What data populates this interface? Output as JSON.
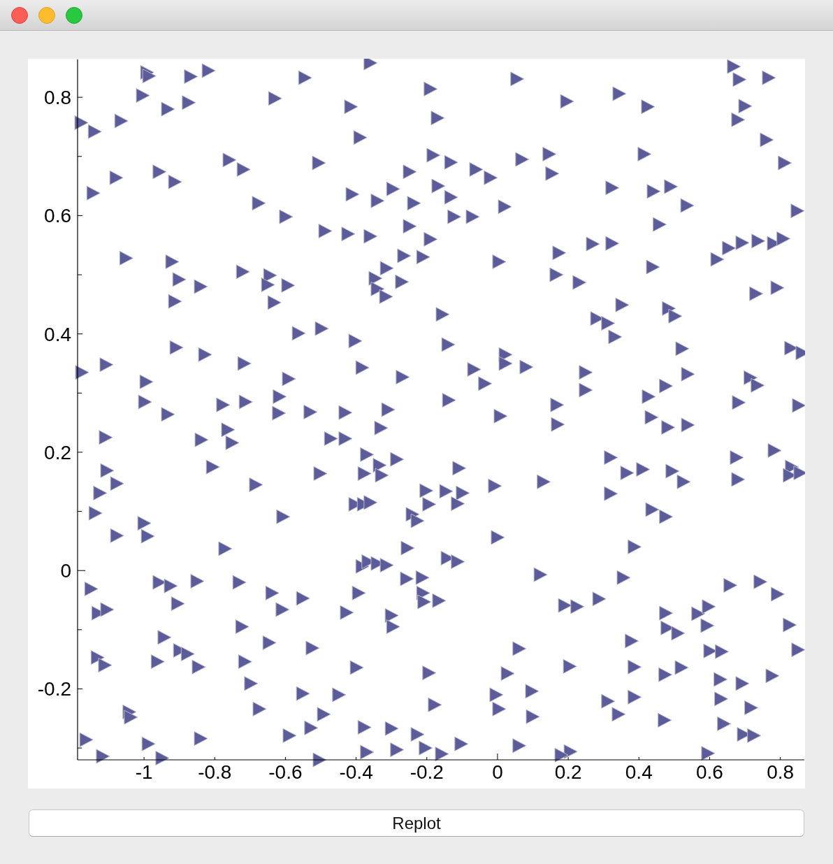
{
  "chart": {
    "chart_data": {
      "type": "scatter",
      "xlim": [
        -1.188,
        0.868
      ],
      "ylim": [
        -0.32,
        0.864
      ],
      "xticks": [
        -1,
        -0.8,
        -0.6,
        -0.4,
        -0.2,
        0,
        0.2,
        0.4,
        0.6,
        0.8
      ],
      "yticks": [
        -0.2,
        0,
        0.2,
        0.4,
        0.6,
        0.8
      ],
      "x": [
        -0.36,
        -0.992,
        -0.986,
        -0.868,
        -0.818,
        -0.545,
        0.055,
        0.668,
        0.684,
        0.767,
        -1.004,
        -0.933,
        -0.874,
        -0.63,
        -0.415,
        -0.19,
        0.196,
        0.344,
        0.425,
        0.7,
        0.68,
        -0.17,
        -1.178,
        -1.14,
        -1.065,
        -0.389,
        0.761,
        0.415,
        -0.759,
        -0.719,
        -0.506,
        -0.182,
        -0.132,
        -0.061,
        -0.02,
        -0.249,
        0.146,
        0.154,
        0.069,
        0.812,
        -0.957,
        -0.913,
        -1.079,
        -1.144,
        -0.411,
        -0.34,
        -0.296,
        -0.168,
        -0.132,
        -0.237,
        0.02,
        0.324,
        0.441,
        0.49,
        0.536,
        -0.676,
        -0.599,
        0.848,
        -0.488,
        -0.423,
        -0.36,
        -0.249,
        -0.19,
        -0.123,
        -0.071,
        0.458,
        -1.051,
        -0.921,
        0.174,
        0.269,
        0.324,
        -0.265,
        -0.211,
        0.004,
        0.621,
        0.654,
        0.692,
        0.737,
        0.781,
        0.808,
        -0.721,
        -0.644,
        -0.314,
        -0.346,
        -0.271,
        0.439,
        0.166,
        0.231,
        -0.901,
        -0.84,
        -0.65,
        -0.593,
        -0.913,
        -0.632,
        -0.34,
        -0.316,
        0.731,
        0.791,
        -0.156,
        0.352,
        0.484,
        0.502,
        0.281,
        0.312,
        0.332,
        -0.563,
        -0.498,
        -0.403,
        -0.14,
        0.022,
        0.522,
        0.83,
        0.862,
        -0.909,
        -0.828,
        -1.176,
        -1.107,
        -0.717,
        -0.383,
        -0.269,
        -0.591,
        -0.067,
        -0.036,
        0.022,
        0.081,
        0.249,
        0.249,
        0.538,
        0.476,
        0.715,
        0.735,
        -0.994,
        -0.998,
        -0.777,
        -0.713,
        -0.617,
        -0.619,
        -0.53,
        -0.431,
        -0.31,
        -0.138,
        0.168,
        0.427,
        0.682,
        0.852,
        -0.933,
        0.008,
        0.435,
        0.482,
        0.538,
        0.17,
        -0.763,
        -0.751,
        -0.33,
        -1.109,
        -0.838,
        -0.472,
        -0.431,
        -0.37,
        -0.285,
        0.783,
        0.32,
        0.676,
        -0.806,
        -1.105,
        -1.077,
        -1.125,
        -1.138,
        -0.502,
        -0.334,
        -0.377,
        -0.328,
        -0.109,
        0.366,
        0.411,
        0.494,
        0.526,
        0.832,
        0.826,
        0.856,
        -0.684,
        -0.202,
        -0.146,
        -0.099,
        -0.008,
        0.13,
        0.32,
        0.68,
        -0.403,
        -0.379,
        -0.36,
        -0.194,
        -0.113,
        -0.241,
        -0.227,
        0.437,
        0.476,
        -0.607,
        -1,
        -0.99,
        -1.077,
        0,
        -0.771,
        -0.255,
        0.387,
        -0.142,
        -0.113,
        -0.383,
        -0.366,
        -0.34,
        -0.314,
        -0.731,
        -0.957,
        -0.925,
        -0.85,
        -1.15,
        -0.905,
        -0.638,
        -0.551,
        -0.393,
        -0.257,
        -0.213,
        -0.211,
        -0.208,
        -0.166,
        0.121,
        0.356,
        0.658,
        0.743,
        0.792,
        -0.609,
        0.19,
        0.225,
        0.287,
        -0.427,
        -0.3,
        -0.296,
        -1.13,
        -1.105,
        0.476,
        0.48,
        0.51,
        0.567,
        0.597,
        0.593,
        0.826,
        -0.723,
        -0.943,
        -0.899,
        -0.877,
        -0.646,
        -0.524,
        0.061,
        0.379,
        0.85,
        -1.132,
        -1.111,
        -0.962,
        -0.846,
        -0.715,
        -0.399,
        -0.194,
        0.028,
        0.204,
        0.387,
        0.474,
        0.52,
        0.601,
        0.634,
        0.63,
        0.692,
        0.777,
        -0.698,
        -0.551,
        -0.449,
        -0.004,
        0.097,
        0.312,
        0.387,
        0.632,
        0.717,
        -0.178,
        0.004,
        -1.042,
        -1.038,
        -0.492,
        -0.674,
        0.342,
        0.099,
        0.472,
        0.64,
        0.696,
        0.725,
        -0.377,
        -0.3,
        -0.528,
        -0.589,
        -0.84,
        -0.227,
        -1.164,
        -0.988,
        -0.103,
        0.061,
        -0.204,
        -0.285,
        -0.37,
        0.206,
        0.18,
        0.595,
        -0.158,
        -1.117,
        -0.949,
        -0.504
      ],
      "series": [
        {
          "color": "#5b5c99",
          "values": [
            0.858,
            0.842,
            0.836,
            0.835,
            0.845,
            0.833,
            0.831,
            0.852,
            0.83,
            0.833,
            0.803,
            0.78,
            0.791,
            0.798,
            0.784,
            0.814,
            0.793,
            0.806,
            0.784,
            0.785,
            0.762,
            0.765,
            0.757,
            0.742,
            0.76,
            0.732,
            0.728,
            0.704,
            0.694,
            0.678,
            0.689,
            0.702,
            0.69,
            0.678,
            0.664,
            0.674,
            0.704,
            0.671,
            0.695,
            0.689,
            0.674,
            0.657,
            0.664,
            0.638,
            0.636,
            0.625,
            0.645,
            0.65,
            0.631,
            0.621,
            0.615,
            0.647,
            0.641,
            0.649,
            0.617,
            0.621,
            0.598,
            0.608,
            0.574,
            0.569,
            0.565,
            0.582,
            0.56,
            0.598,
            0.598,
            0.585,
            0.528,
            0.522,
            0.537,
            0.552,
            0.553,
            0.532,
            0.53,
            0.522,
            0.526,
            0.545,
            0.554,
            0.557,
            0.553,
            0.561,
            0.505,
            0.499,
            0.511,
            0.494,
            0.488,
            0.513,
            0.5,
            0.487,
            0.492,
            0.48,
            0.483,
            0.482,
            0.455,
            0.453,
            0.476,
            0.463,
            0.468,
            0.478,
            0.433,
            0.449,
            0.443,
            0.43,
            0.426,
            0.418,
            0.395,
            0.401,
            0.409,
            0.388,
            0.382,
            0.365,
            0.375,
            0.376,
            0.368,
            0.377,
            0.365,
            0.335,
            0.348,
            0.35,
            0.343,
            0.327,
            0.324,
            0.34,
            0.316,
            0.35,
            0.344,
            0.335,
            0.305,
            0.332,
            0.312,
            0.326,
            0.313,
            0.319,
            0.285,
            0.28,
            0.285,
            0.294,
            0.266,
            0.268,
            0.267,
            0.272,
            0.288,
            0.28,
            0.294,
            0.284,
            0.279,
            0.264,
            0.261,
            0.259,
            0.242,
            0.246,
            0.247,
            0.238,
            0.216,
            0.241,
            0.225,
            0.221,
            0.223,
            0.223,
            0.196,
            0.188,
            0.203,
            0.191,
            0.191,
            0.175,
            0.169,
            0.147,
            0.131,
            0.097,
            0.164,
            0.178,
            0.164,
            0.161,
            0.173,
            0.165,
            0.171,
            0.168,
            0.15,
            0.175,
            0.161,
            0.165,
            0.145,
            0.135,
            0.134,
            0.131,
            0.143,
            0.15,
            0.13,
            0.154,
            0.112,
            0.112,
            0.115,
            0.112,
            0.113,
            0.095,
            0.084,
            0.103,
            0.091,
            0.091,
            0.08,
            0.058,
            0.059,
            0.056,
            0.037,
            0.038,
            0.04,
            0.021,
            0.015,
            0.007,
            0.015,
            0.012,
            0.009,
            -0.02,
            -0.02,
            -0.026,
            -0.018,
            -0.031,
            -0.056,
            -0.038,
            -0.047,
            -0.038,
            -0.014,
            -0.012,
            -0.038,
            -0.053,
            -0.051,
            -0.007,
            -0.012,
            -0.025,
            -0.019,
            -0.04,
            -0.066,
            -0.059,
            -0.061,
            -0.048,
            -0.071,
            -0.076,
            -0.095,
            -0.072,
            -0.066,
            -0.072,
            -0.097,
            -0.106,
            -0.073,
            -0.061,
            -0.093,
            -0.092,
            -0.095,
            -0.113,
            -0.135,
            -0.141,
            -0.122,
            -0.131,
            -0.132,
            -0.119,
            -0.134,
            -0.147,
            -0.16,
            -0.154,
            -0.163,
            -0.154,
            -0.164,
            -0.173,
            -0.174,
            -0.162,
            -0.163,
            -0.176,
            -0.164,
            -0.136,
            -0.137,
            -0.184,
            -0.191,
            -0.178,
            -0.191,
            -0.208,
            -0.21,
            -0.21,
            -0.204,
            -0.221,
            -0.214,
            -0.217,
            -0.232,
            -0.227,
            -0.234,
            -0.239,
            -0.248,
            -0.243,
            -0.234,
            -0.243,
            -0.247,
            -0.253,
            -0.259,
            -0.277,
            -0.279,
            -0.265,
            -0.267,
            -0.266,
            -0.279,
            -0.284,
            -0.277,
            -0.286,
            -0.293,
            -0.293,
            -0.296,
            -0.3,
            -0.303,
            -0.307,
            -0.306,
            -0.312,
            -0.309,
            -0.31,
            -0.314,
            -0.317,
            -0.32
          ]
        }
      ]
    }
  },
  "buttons": [
    {
      "label": "Replot"
    }
  ]
}
